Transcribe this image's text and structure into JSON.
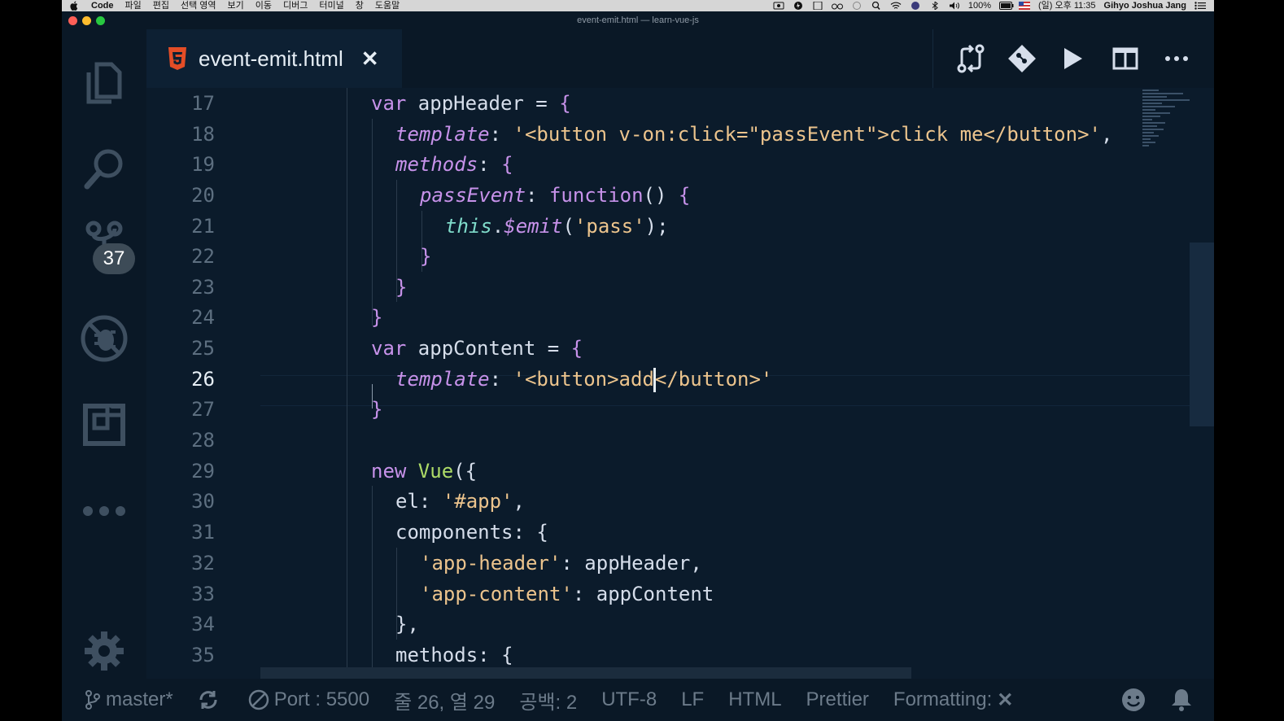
{
  "menubar": {
    "app": "Code",
    "items": [
      "파일",
      "편집",
      "선택 영역",
      "보기",
      "이동",
      "디버그",
      "터미널",
      "창",
      "도움말"
    ],
    "battery": "100%",
    "clock": "(일) 오후 11:35",
    "user": "Gihyo Joshua Jang"
  },
  "window": {
    "title": "event-emit.html — learn-vue-js",
    "colors": {
      "background": "#0b1b2b",
      "close": "#ff5f57",
      "minimize": "#febc2e",
      "zoom": "#28c840"
    }
  },
  "activity": {
    "scm_badge": "37"
  },
  "tab": {
    "filename": "event-emit.html",
    "close": "✕"
  },
  "editor": {
    "cursor_line": 26,
    "line_numbers": [
      "17",
      "18",
      "19",
      "20",
      "21",
      "22",
      "23",
      "24",
      "25",
      "26",
      "27",
      "28",
      "29",
      "30",
      "31",
      "32",
      "33",
      "34",
      "35"
    ]
  },
  "code": {
    "l17": {
      "kw": "var",
      "name": " appHeader",
      "eq": " = ",
      "brace": "{"
    },
    "l18": {
      "prop": "template",
      "colon": ": ",
      "str": "'<button v-on:click=\"passEvent\">click me</button>'",
      "comma": ","
    },
    "l19": {
      "prop": "methods",
      "colon": ": ",
      "brace": "{"
    },
    "l20": {
      "prop": "passEvent",
      "colon": ": ",
      "fn": "function",
      "paren": "() ",
      "brace": "{"
    },
    "l21": {
      "this": "this",
      "dot": ".",
      "method": "$emit",
      "open": "(",
      "str": "'pass'",
      "close": ");"
    },
    "l22": {
      "brace": "}"
    },
    "l23": {
      "brace": "}"
    },
    "l24": {
      "brace": "}"
    },
    "l25": {
      "kw": "var",
      "name": " appContent",
      "eq": " = ",
      "brace": "{"
    },
    "l26": {
      "prop": "template",
      "colon": ": ",
      "str_a": "'<button>add",
      "str_b": "</button>'"
    },
    "l27": {
      "brace": "}"
    },
    "l29": {
      "kw": "new",
      "cls": " Vue",
      "open": "({"
    },
    "l30": {
      "key": "el",
      "colon": ": ",
      "str": "'#app'",
      "comma": ","
    },
    "l31": {
      "key": "components",
      "colon": ": ",
      "brace": "{"
    },
    "l32": {
      "str": "'app-header'",
      "colon": ": ",
      "val": "appHeader",
      "comma": ","
    },
    "l33": {
      "str": "'app-content'",
      "colon": ": ",
      "val": "appContent"
    },
    "l34": {
      "brace": "},"
    },
    "l35": {
      "key": "methods",
      "colon": ": ",
      "brace": "{"
    }
  },
  "status": {
    "branch": "master*",
    "port": "Port : 5500",
    "position": "줄 26, 열 29",
    "spaces": "공백: 2",
    "encoding": "UTF-8",
    "eol": "LF",
    "language": "HTML",
    "formatter": "Prettier",
    "formatting": "Formatting:",
    "formatting_state": "✕"
  }
}
